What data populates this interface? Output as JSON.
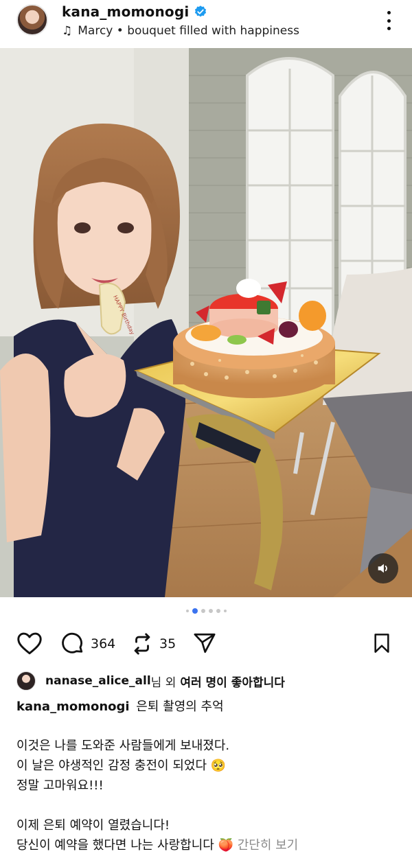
{
  "header": {
    "username": "kana_momonogi",
    "music": "Marcy • bouquet filled with happiness",
    "icons": {
      "music": "music-note-icon",
      "verified": "verified-badge-icon",
      "more": "more-vertical-icon"
    }
  },
  "photo": {
    "description_icon": "photo",
    "cake_plaque_text": "HAPPY Birthday"
  },
  "carousel": {
    "total": 6,
    "active_index": 0
  },
  "actions": {
    "comment_count": "364",
    "repost_count": "35"
  },
  "likes": {
    "user": "nanase_alice_all",
    "suffix": "님 외",
    "emphasis": "여러 명이 좋아합니다"
  },
  "caption": {
    "username": "kana_momonogi",
    "title": "은퇴 촬영의 추억",
    "lines": [
      "이것은 나를 도와준 사람들에게 보내졌다.",
      "이 날은 야생적인 감정 충전이 되었다 🥺",
      "정말 고마워요!!!",
      "",
      "이제 은퇴 예약이 열렸습니다!",
      "당신이 예약을 했다면 나는 사랑합니다 🍑"
    ],
    "more_label": "간단히 보기"
  },
  "colors": {
    "accent": "#3b73ef",
    "verified": "#1d9bf0",
    "muted": "#8a8a8a"
  }
}
